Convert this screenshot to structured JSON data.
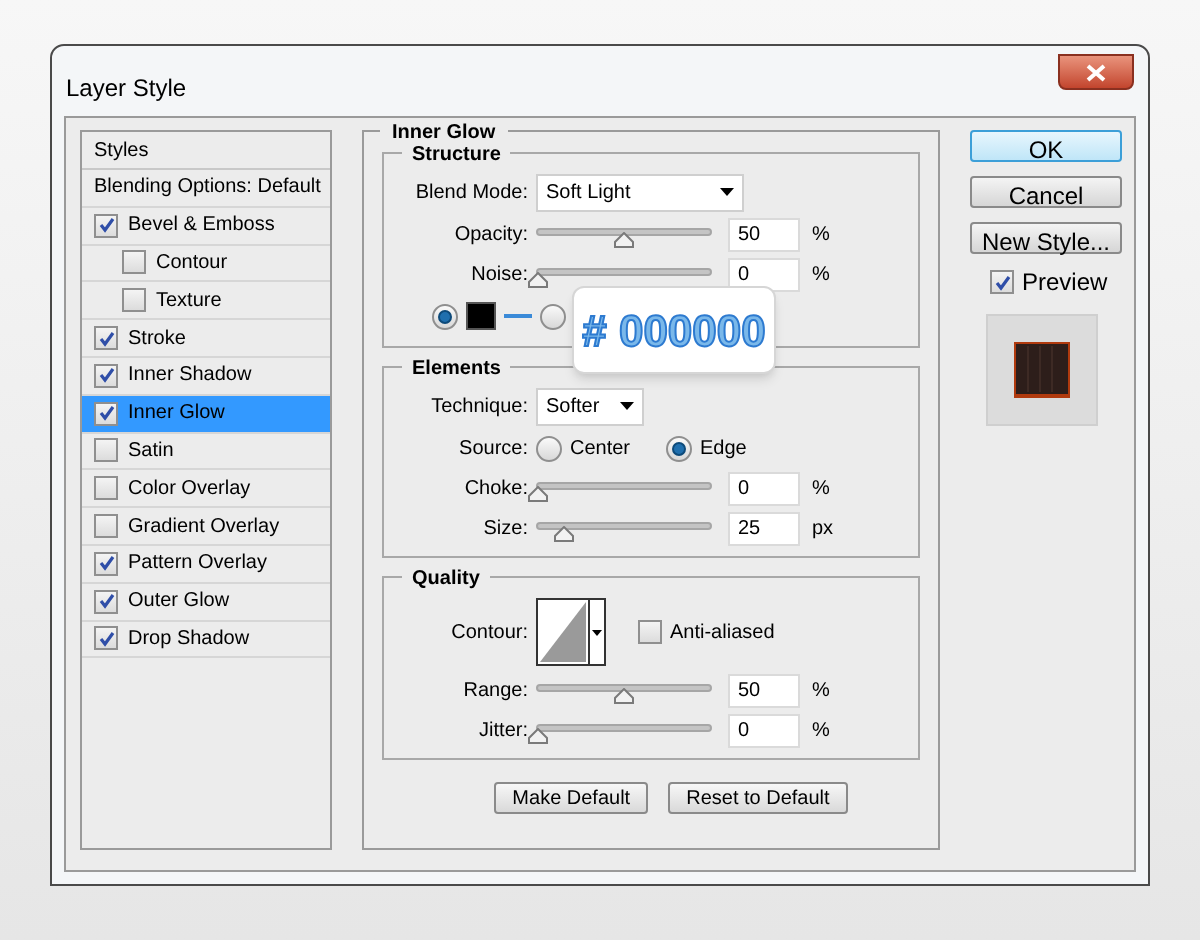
{
  "window": {
    "title": "Layer Style"
  },
  "styles_list": {
    "header": "Styles",
    "items": [
      {
        "label": "Blending Options: Default",
        "kind": "plain",
        "selected": false
      },
      {
        "label": "Bevel & Emboss",
        "kind": "check",
        "checked": true,
        "selected": false,
        "children": [
          {
            "label": "Contour",
            "kind": "check",
            "checked": false,
            "selected": false
          },
          {
            "label": "Texture",
            "kind": "check",
            "checked": false,
            "selected": false
          }
        ]
      },
      {
        "label": "Stroke",
        "kind": "check",
        "checked": true,
        "selected": false
      },
      {
        "label": "Inner Shadow",
        "kind": "check",
        "checked": true,
        "selected": false
      },
      {
        "label": "Inner Glow",
        "kind": "check",
        "checked": true,
        "selected": true
      },
      {
        "label": "Satin",
        "kind": "check",
        "checked": false,
        "selected": false
      },
      {
        "label": "Color Overlay",
        "kind": "check",
        "checked": false,
        "selected": false
      },
      {
        "label": "Gradient Overlay",
        "kind": "check",
        "checked": false,
        "selected": false
      },
      {
        "label": "Pattern Overlay",
        "kind": "check",
        "checked": true,
        "selected": false
      },
      {
        "label": "Outer Glow",
        "kind": "check",
        "checked": true,
        "selected": false
      },
      {
        "label": "Drop Shadow",
        "kind": "check",
        "checked": true,
        "selected": false
      }
    ]
  },
  "panel": {
    "title": "Inner Glow",
    "sections": [
      {
        "title": "Structure",
        "rows": [
          {
            "kind": "dropdown",
            "label": "Blend Mode:",
            "value": "Soft Light"
          },
          {
            "kind": "slider",
            "label": "Opacity:",
            "value": "50",
            "unit": "%",
            "level": 0.5
          },
          {
            "kind": "slider",
            "label": "Noise:",
            "value": "0",
            "unit": "%",
            "level": 0
          },
          {
            "kind": "color",
            "options": [
              {
                "selected": true
              },
              {
                "selected": false
              }
            ],
            "callout": "# 000000"
          }
        ]
      },
      {
        "title": "Elements",
        "rows": [
          {
            "kind": "dropdown",
            "label": "Technique:",
            "value": "Softer"
          },
          {
            "kind": "radios",
            "label": "Source:",
            "options": [
              {
                "label": "Center",
                "selected": false
              },
              {
                "label": "Edge",
                "selected": true
              }
            ]
          },
          {
            "kind": "slider",
            "label": "Choke:",
            "value": "0",
            "unit": "%",
            "level": 0
          },
          {
            "kind": "slider",
            "label": "Size:",
            "value": "25",
            "unit": "px",
            "level": 0.15
          }
        ]
      },
      {
        "title": "Quality",
        "rows": [
          {
            "kind": "contour",
            "label": "Contour:",
            "checkbox": {
              "label": "Anti-aliased",
              "checked": false
            }
          },
          {
            "kind": "slider",
            "label": "Range:",
            "value": "50",
            "unit": "%",
            "level": 0.5
          },
          {
            "kind": "slider",
            "label": "Jitter:",
            "value": "0",
            "unit": "%",
            "level": 0
          }
        ]
      }
    ],
    "buttons": [
      "Make Default",
      "Reset to Default"
    ]
  },
  "side": {
    "buttons": [
      {
        "label": "OK",
        "primary": true
      },
      {
        "label": "Cancel",
        "primary": false
      },
      {
        "label": "New Style...",
        "primary": false
      }
    ],
    "preview": {
      "label": "Preview",
      "checked": true
    }
  }
}
